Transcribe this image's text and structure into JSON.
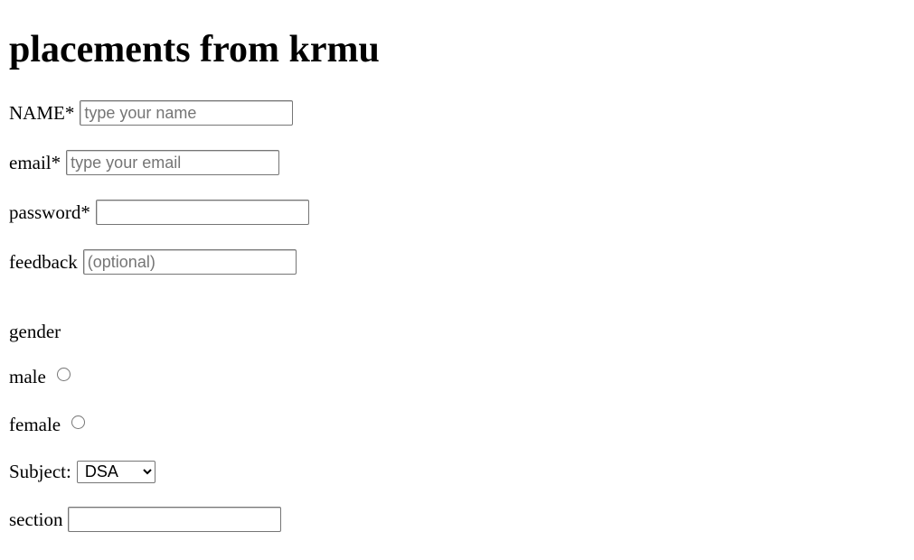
{
  "page": {
    "title": "placements from krmu"
  },
  "form": {
    "name": {
      "label": "NAME*",
      "placeholder": "type your name",
      "value": ""
    },
    "email": {
      "label": "email*",
      "placeholder": "type your email",
      "value": ""
    },
    "password": {
      "label": "password*",
      "placeholder": "",
      "value": ""
    },
    "feedback": {
      "label": "feedback",
      "placeholder": "(optional)",
      "value": ""
    },
    "gender": {
      "label": "gender",
      "options": [
        {
          "label": "male",
          "checked": false
        },
        {
          "label": "female",
          "checked": false
        }
      ]
    },
    "subject": {
      "label": "Subject:",
      "selected": "DSA"
    },
    "section": {
      "label": "section",
      "placeholder": "",
      "value": ""
    }
  }
}
